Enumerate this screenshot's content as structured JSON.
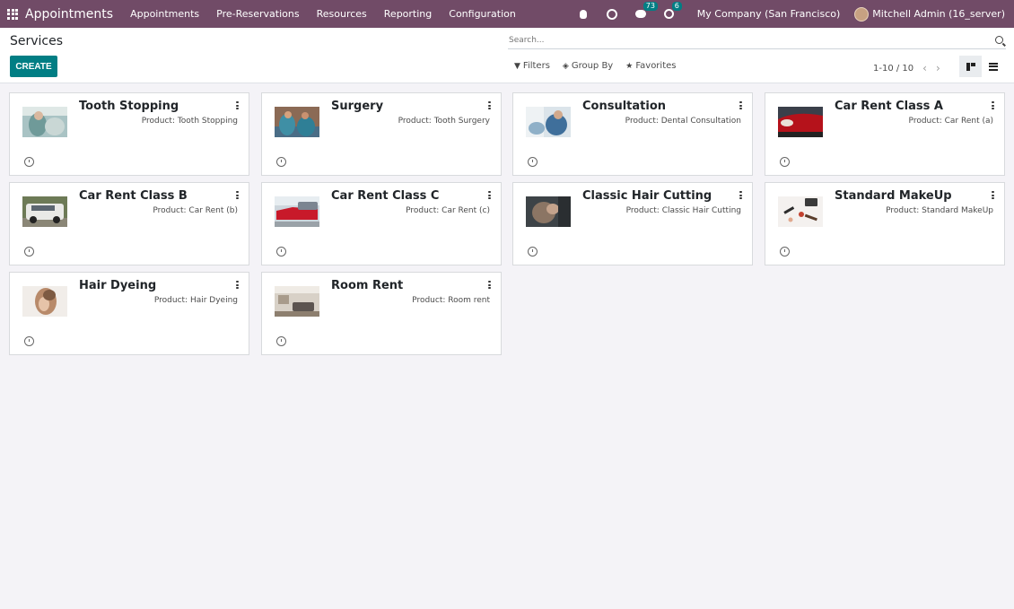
{
  "topbar": {
    "app_name": "Appointments",
    "menu": [
      "Appointments",
      "Pre-Reservations",
      "Resources",
      "Reporting",
      "Configuration"
    ],
    "messages_count": "73",
    "activities_count": "6",
    "company": "My Company (San Francisco)",
    "user": "Mitchell Admin (16_server)"
  },
  "control": {
    "breadcrumb": "Services",
    "create_label": "CREATE",
    "search_placeholder": "Search...",
    "filters_label": "Filters",
    "groupby_label": "Group By",
    "favorites_label": "Favorites",
    "pager": "1-10 / 10"
  },
  "cards": [
    {
      "title": "Tooth Stopping",
      "subtitle": "Product: Tooth Stopping",
      "image": "dental-photo"
    },
    {
      "title": "Surgery",
      "subtitle": "Product: Tooth Surgery",
      "image": "surgery-photo"
    },
    {
      "title": "Consultation",
      "subtitle": "Product: Dental Consultation",
      "image": "consultation-photo"
    },
    {
      "title": "Car Rent Class A",
      "subtitle": "Product: Car Rent (a)",
      "image": "red-car-photo"
    },
    {
      "title": "Car Rent Class B",
      "subtitle": "Product: Car Rent (b)",
      "image": "suv-photo"
    },
    {
      "title": "Car Rent Class C",
      "subtitle": "Product: Car Rent (c)",
      "image": "cars-photo"
    },
    {
      "title": "Classic Hair Cutting",
      "subtitle": "Product: Classic Hair Cutting",
      "image": "haircut-photo"
    },
    {
      "title": "Standard MakeUp",
      "subtitle": "Product: Standard MakeUp",
      "image": "makeup-photo"
    },
    {
      "title": "Hair Dyeing",
      "subtitle": "Product: Hair Dyeing",
      "image": "hair-dye-photo"
    },
    {
      "title": "Room Rent",
      "subtitle": "Product: Room rent",
      "image": "room-photo"
    }
  ],
  "colors": {
    "brand": "#714b67",
    "primary_button": "#017e84",
    "background": "#f4f3f7"
  }
}
